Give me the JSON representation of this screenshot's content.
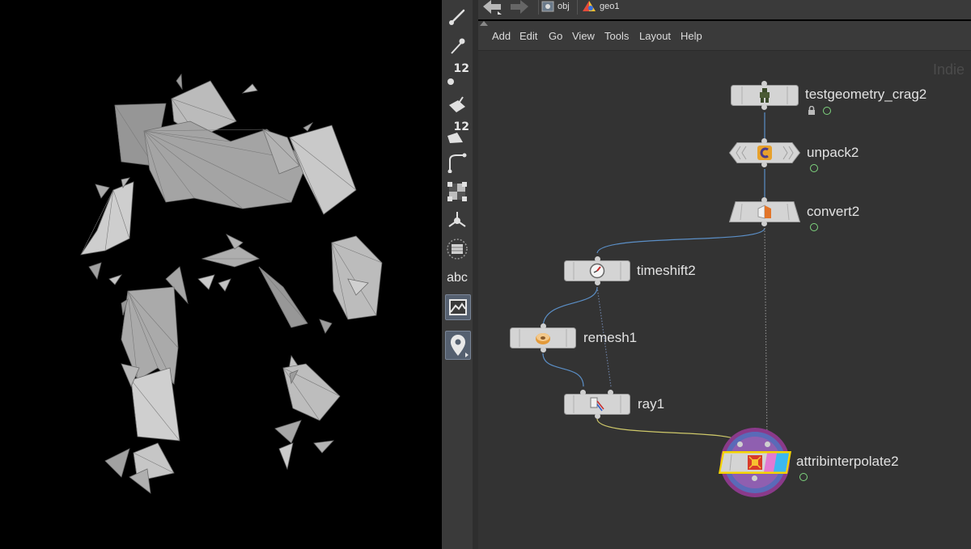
{
  "path_bar": {
    "crumbs": [
      {
        "label": "obj",
        "icon": "object-network-icon"
      },
      {
        "label": "geo1",
        "icon": "geometry-object-icon"
      }
    ]
  },
  "menu": {
    "items": [
      "Add",
      "Edit",
      "Go",
      "View",
      "Tools",
      "Layout",
      "Help"
    ]
  },
  "shelf": {
    "tools": [
      {
        "icon": "brush-tool-icon"
      },
      {
        "icon": "pin-tool-icon"
      },
      {
        "icon": "point-count-icon",
        "badge": "12"
      },
      {
        "icon": "transform-tool-icon"
      },
      {
        "icon": "primitive-count-icon",
        "badge": "12"
      },
      {
        "icon": "edge-curve-tool-icon"
      },
      {
        "icon": "checker-uv-icon"
      },
      {
        "icon": "pivot-handle-icon"
      },
      {
        "icon": "ghost-display-icon"
      },
      {
        "icon": "text-label-tool-icon",
        "badge": "abc"
      },
      {
        "icon": "background-image-icon"
      },
      {
        "icon": "location-pin-tool-icon"
      }
    ]
  },
  "network": {
    "watermark": "Indie",
    "nodes": [
      {
        "id": "testgeometry_crag2",
        "label": "testgeometry_crag2",
        "icon": "crag-robot-icon",
        "locked": true
      },
      {
        "id": "unpack2",
        "label": "unpack2",
        "icon": "unpack-icon"
      },
      {
        "id": "convert2",
        "label": "convert2",
        "icon": "convert-icon"
      },
      {
        "id": "timeshift2",
        "label": "timeshift2",
        "icon": "timeshift-clock-icon"
      },
      {
        "id": "remesh1",
        "label": "remesh1",
        "icon": "remesh-donut-icon"
      },
      {
        "id": "ray1",
        "label": "ray1",
        "icon": "ray-icon"
      },
      {
        "id": "attribinterpolate2",
        "label": "attribinterpolate2",
        "icon": "attribinterpolate-icon",
        "display_flag": true
      }
    ],
    "connections": [
      {
        "from": "testgeometry_crag2",
        "to": "unpack2"
      },
      {
        "from": "unpack2",
        "to": "convert2"
      },
      {
        "from": "convert2",
        "to": "timeshift2"
      },
      {
        "from": "convert2",
        "to": "attribinterpolate2",
        "style": "dotted"
      },
      {
        "from": "timeshift2",
        "to": "remesh1"
      },
      {
        "from": "timeshift2",
        "to": "ray1",
        "style": "dotted"
      },
      {
        "from": "remesh1",
        "to": "ray1"
      },
      {
        "from": "ray1",
        "to": "attribinterpolate2",
        "highlight": true
      }
    ]
  },
  "colors": {
    "viewport_bg": "#000000",
    "network_bg": "#333333",
    "panel_bg": "#3a3a3a",
    "node_fill": "#d4d4d4",
    "display_flag_ring": "#9b3f9b",
    "selected_outline": "#f5d300",
    "wire": "#5b8fc7",
    "flag_green": "#7fd67f"
  }
}
